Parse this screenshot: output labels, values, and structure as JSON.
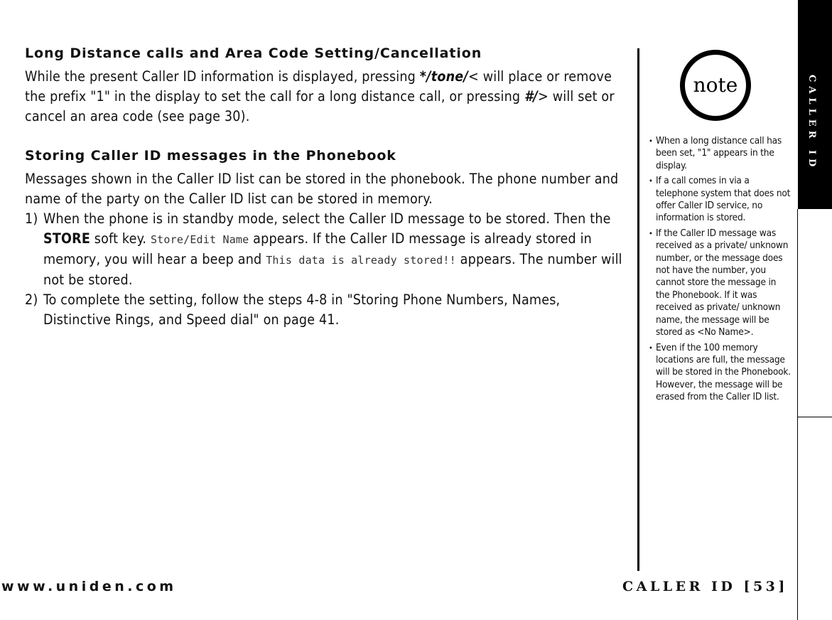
{
  "section1": {
    "heading": "Long Distance calls and Area Code Setting/Cancellation",
    "para_parts": [
      "While the present Caller ID information is displayed, pressing ",
      "*/tone/",
      "< will place or remove the prefix \"1\" in the display to set the call for a long distance call, or pressing ",
      "#/",
      "> will set or cancel an area code (see page 30)."
    ]
  },
  "section2": {
    "heading": "Storing Caller ID messages in the Phonebook",
    "intro": "Messages shown in the Caller ID list can be stored in the phonebook. The phone number and name of the party on the Caller ID list can be stored in memory.",
    "steps": [
      {
        "num": "1)",
        "parts": [
          "When the phone is in standby mode, select the Caller ID message to be stored. Then the ",
          "STORE",
          " soft key. ",
          "Store/Edit Name",
          " appears. If the Caller ID message is already stored in memory, you will hear a beep and ",
          "This data is already stored!!",
          " appears. The number will not be stored."
        ]
      },
      {
        "num": "2)",
        "text": "To complete the setting, follow the steps 4-8 in \"Storing Phone Numbers, Names, Distinctive Rings, and Speed dial\" on page 41."
      }
    ]
  },
  "note": {
    "icon_label": "note",
    "bullet": "•",
    "items": [
      "When a long distance call has been set, \"1\" appears in the display.",
      "If a call comes in via a telephone system that does not offer Caller ID service, no information is stored.",
      "If the Caller ID message was received as a private/ unknown number, or the message does not have the number, you cannot store the message in the Phonebook. If it was received as private/ unknown name, the message will be stored as <No Name>.",
      "Even if the 100 memory locations are full, the message will be stored in the Phonebook. However, the message will be erased from the Caller ID list."
    ]
  },
  "side_tab": {
    "label": "CALLER ID"
  },
  "footer": {
    "website": "www.uniden.com",
    "page_label": "CALLER ID [53]"
  }
}
